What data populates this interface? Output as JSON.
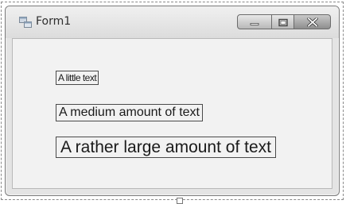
{
  "window": {
    "title": "Form1",
    "icon": "form-icon",
    "caption_buttons": {
      "minimize_icon": "minimize-icon",
      "maximize_icon": "maximize-icon",
      "close_icon": "close-icon"
    }
  },
  "labels": {
    "small": "A little text",
    "medium": "A medium amount of text",
    "large": "A rather large amount of text"
  }
}
